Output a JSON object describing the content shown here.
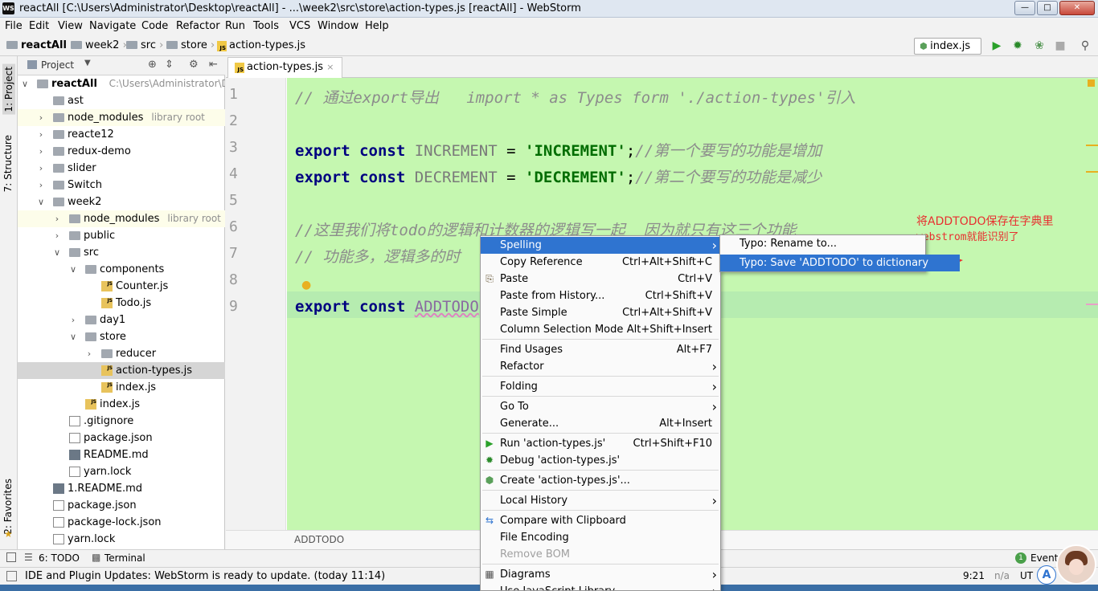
{
  "window": {
    "title": "reactAll [C:\\Users\\Administrator\\Desktop\\reactAll] - ...\\week2\\src\\store\\action-types.js [reactAll] - WebStorm",
    "app_icon": "WS"
  },
  "menu": [
    "File",
    "Edit",
    "View",
    "Navigate",
    "Code",
    "Refactor",
    "Run",
    "Tools",
    "VCS",
    "Window",
    "Help"
  ],
  "breadcrumbs": [
    "reactAll",
    "week2",
    "src",
    "store",
    "action-types.js"
  ],
  "toolbar": {
    "run_config": "index.js"
  },
  "left_stripe": {
    "project": "1: Project",
    "structure": "7: Structure",
    "favorites": "2: Favorites"
  },
  "project_panel": {
    "title": "Project",
    "tree": [
      {
        "label": "reactAll",
        "note": "C:\\Users\\Administrator\\Desk",
        "level": 0,
        "type": "root",
        "expanded": true
      },
      {
        "label": "ast",
        "level": 1,
        "type": "folder"
      },
      {
        "label": "node_modules",
        "note": "library root",
        "level": 1,
        "type": "folder",
        "arrow": "right",
        "lib": true
      },
      {
        "label": "reacte12",
        "level": 1,
        "type": "folder",
        "arrow": "right"
      },
      {
        "label": "redux-demo",
        "level": 1,
        "type": "folder",
        "arrow": "right"
      },
      {
        "label": "slider",
        "level": 1,
        "type": "folder",
        "arrow": "right"
      },
      {
        "label": "Switch",
        "level": 1,
        "type": "folder",
        "arrow": "right"
      },
      {
        "label": "week2",
        "level": 1,
        "type": "folder",
        "arrow": "down"
      },
      {
        "label": "node_modules",
        "note": "library root",
        "level": 2,
        "type": "folder",
        "arrow": "right",
        "lib": true
      },
      {
        "label": "public",
        "level": 2,
        "type": "folder",
        "arrow": "right"
      },
      {
        "label": "src",
        "level": 2,
        "type": "folder",
        "arrow": "down"
      },
      {
        "label": "components",
        "level": 3,
        "type": "folder",
        "arrow": "down"
      },
      {
        "label": "Counter.js",
        "level": 4,
        "type": "js"
      },
      {
        "label": "Todo.js",
        "level": 4,
        "type": "js"
      },
      {
        "label": "day1",
        "level": 3,
        "type": "folder",
        "arrow": "right"
      },
      {
        "label": "store",
        "level": 3,
        "type": "folder",
        "arrow": "down"
      },
      {
        "label": "reducer",
        "level": 4,
        "type": "folder",
        "arrow": "right"
      },
      {
        "label": "action-types.js",
        "level": 4,
        "type": "js",
        "selected": true
      },
      {
        "label": "index.js",
        "level": 4,
        "type": "js"
      },
      {
        "label": "index.js",
        "level": 3,
        "type": "js"
      },
      {
        "label": ".gitignore",
        "level": 2,
        "type": "file"
      },
      {
        "label": "package.json",
        "level": 2,
        "type": "file"
      },
      {
        "label": "README.md",
        "level": 2,
        "type": "md"
      },
      {
        "label": "yarn.lock",
        "level": 2,
        "type": "file"
      },
      {
        "label": "1.README.md",
        "level": 1,
        "type": "md"
      },
      {
        "label": "package.json",
        "level": 1,
        "type": "file"
      },
      {
        "label": "package-lock.json",
        "level": 1,
        "type": "file"
      },
      {
        "label": "yarn.lock",
        "level": 1,
        "type": "file"
      }
    ]
  },
  "editor": {
    "tab": "action-types.js",
    "line_numbers": [
      "1",
      "2",
      "3",
      "4",
      "5",
      "6",
      "7",
      "8",
      "9"
    ],
    "lines": {
      "l1": "// 通过export导出   import * as Types form './action-types'引入",
      "l3_kw": "export const ",
      "l3_name": "INCREMENT",
      "l3_eq": " = ",
      "l3_str": "'INCREMENT'",
      "l3_semi": ";",
      "l3_cmt": "//第一个要写的功能是增加",
      "l4_kw": "export const ",
      "l4_name": "DECREMENT",
      "l4_eq": " = ",
      "l4_str": "'DECREMENT'",
      "l4_semi": ";",
      "l4_cmt": "//第二个要写的功能是减少",
      "l6": "//这里我们将todo的逻辑和计数器的逻辑写一起  因为就只有这三个功能",
      "l7": "// 功能多，逻辑多的时",
      "l9_kw": "export const ",
      "l9_name": "ADDTODO"
    },
    "breadcrumb": "ADDTODO"
  },
  "context_menu": [
    {
      "label": "Spelling",
      "submenu": true,
      "highlight": true
    },
    {
      "label": "Copy Reference",
      "shortcut": "Ctrl+Alt+Shift+C"
    },
    {
      "label": "Paste",
      "shortcut": "Ctrl+V",
      "icon": "paste-icon"
    },
    {
      "label": "Paste from History...",
      "shortcut": "Ctrl+Shift+V"
    },
    {
      "label": "Paste Simple",
      "shortcut": "Ctrl+Alt+Shift+V"
    },
    {
      "label": "Column Selection Mode",
      "shortcut": "Alt+Shift+Insert"
    },
    {
      "sep": true
    },
    {
      "label": "Find Usages",
      "shortcut": "Alt+F7"
    },
    {
      "label": "Refactor",
      "submenu": true
    },
    {
      "sep": true
    },
    {
      "label": "Folding",
      "submenu": true
    },
    {
      "sep": true
    },
    {
      "label": "Go To",
      "submenu": true
    },
    {
      "label": "Generate...",
      "shortcut": "Alt+Insert"
    },
    {
      "sep": true
    },
    {
      "label": "Run 'action-types.js'",
      "shortcut": "Ctrl+Shift+F10",
      "icon": "run-icon"
    },
    {
      "label": "Debug 'action-types.js'",
      "icon": "debug-icon"
    },
    {
      "sep": true
    },
    {
      "label": "Create 'action-types.js'...",
      "icon": "nodejs-icon"
    },
    {
      "sep": true
    },
    {
      "label": "Local History",
      "submenu": true
    },
    {
      "sep": true
    },
    {
      "label": "Compare with Clipboard",
      "icon": "compare-icon"
    },
    {
      "label": "File Encoding"
    },
    {
      "label": "Remove BOM",
      "disabled": true
    },
    {
      "sep": true
    },
    {
      "label": "Diagrams",
      "submenu": true,
      "icon": "diagram-icon"
    },
    {
      "label": "Use JavaScript Library",
      "submenu": true
    }
  ],
  "submenu": [
    {
      "label": "Typo: Rename to..."
    },
    {
      "label": "Typo: Save 'ADDTODO' to dictionary",
      "highlight": true
    }
  ],
  "annotation": {
    "line1": "将ADDTODO保存在字典里",
    "line2": "webstrom就能识别了"
  },
  "bottom_tools": {
    "todo": "6: TODO",
    "terminal": "Terminal",
    "event_count": "1",
    "event_log": "Event L"
  },
  "status": {
    "message": "IDE and Plugin Updates: WebStorm is ready to update. (today 11:14)",
    "position": "9:21",
    "na": "n/a",
    "encoding": "UT"
  },
  "colors": {
    "editor_bg": "#c5f7b0",
    "menu_highlight": "#2f74d0",
    "annotation": "#e83030"
  }
}
